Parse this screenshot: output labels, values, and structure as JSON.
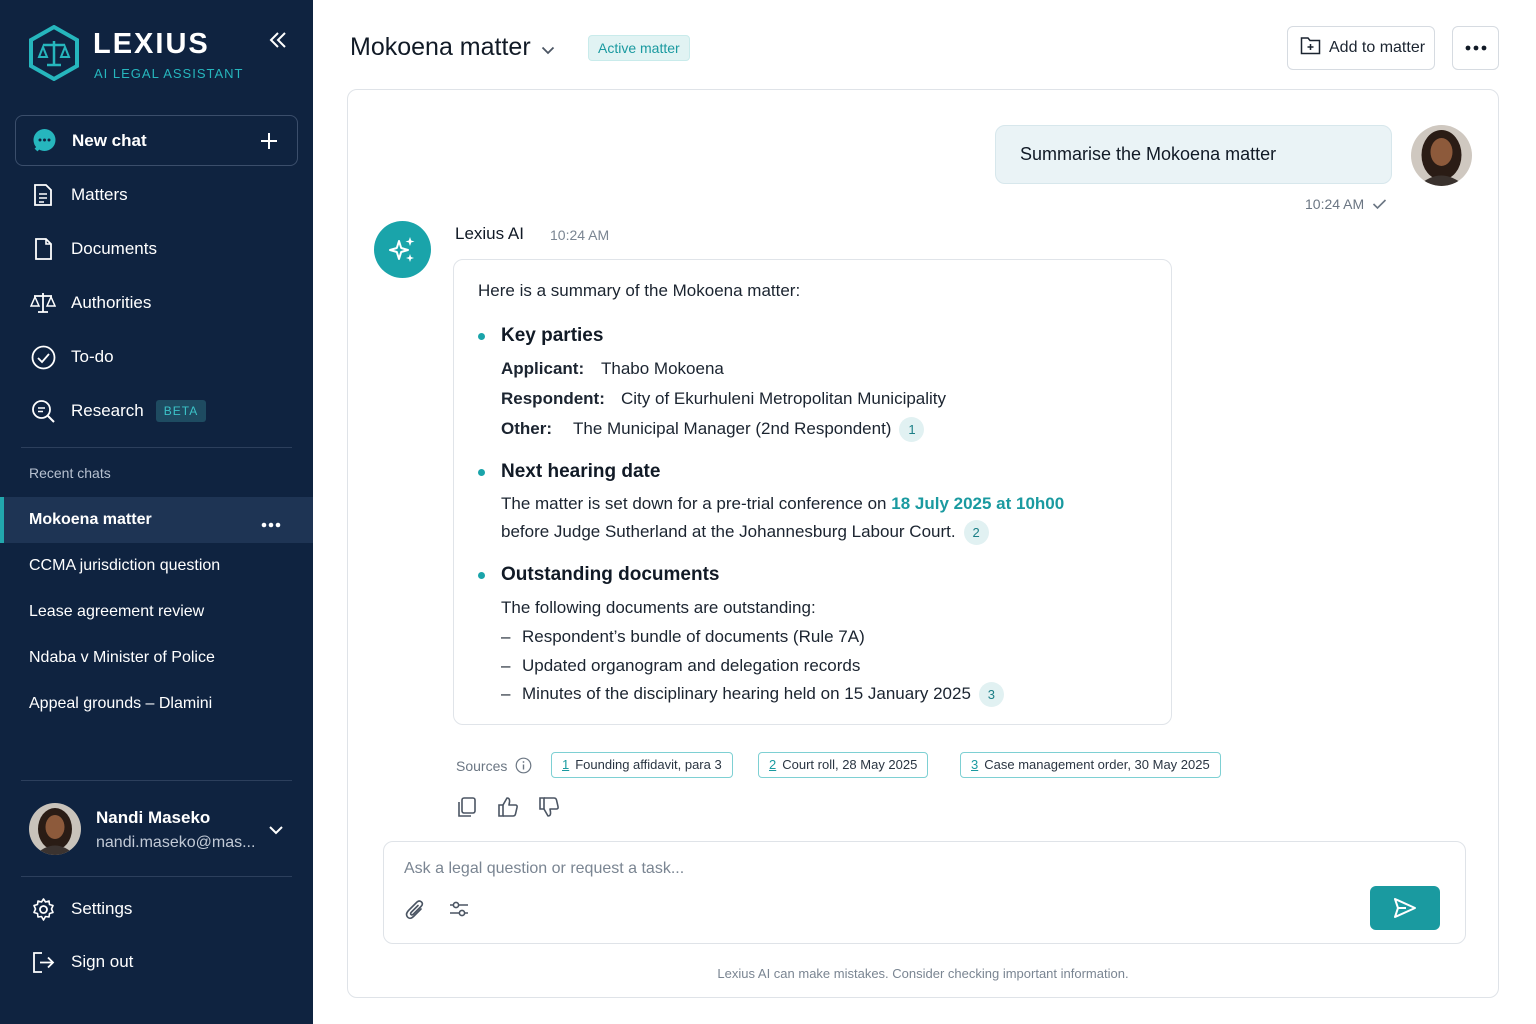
{
  "brand": {
    "name": "LEXIUS",
    "tagline": "AI LEGAL ASSISTANT"
  },
  "sidebar": {
    "new_chat": "New chat",
    "nav": [
      {
        "label": "Matters",
        "icon": "file-lines-icon"
      },
      {
        "label": "Documents",
        "icon": "document-icon"
      },
      {
        "label": "Authorities",
        "icon": "scales-icon"
      },
      {
        "label": "To-do",
        "icon": "check-circle-icon"
      },
      {
        "label": "Research",
        "icon": "search-doc-icon",
        "badge": "BETA"
      }
    ],
    "recent_title": "Recent chats",
    "recent": [
      {
        "label": "Mokoena matter",
        "active": true
      },
      {
        "label": "CCMA jurisdiction question"
      },
      {
        "label": "Lease agreement review"
      },
      {
        "label": "Ndaba v Minister of Police"
      },
      {
        "label": "Appeal grounds – Dlamini"
      }
    ],
    "user": {
      "name": "Nandi Maseko",
      "email": "nandi.maseko@mas..."
    },
    "footer": [
      {
        "label": "Settings",
        "icon": "gear-icon"
      },
      {
        "label": "Sign out",
        "icon": "sign-out-icon"
      }
    ]
  },
  "header": {
    "title": "Mokoena matter",
    "status": "Active matter",
    "add_button": "Add to matter"
  },
  "chat": {
    "user_message": "Summarise the Mokoena matter",
    "user_time": "10:24 AM",
    "ai_name": "Lexius AI",
    "ai_time": "10:24 AM",
    "intro": "Here is a summary of the Mokoena matter:",
    "sections": {
      "parties": {
        "heading": "Key parties",
        "applicant_label": "Applicant:",
        "applicant": "Thabo Mokoena",
        "respondent_label": "Respondent:",
        "respondent": "City of Ekurhuleni Metropolitan Municipality",
        "other_label": "Other:",
        "other": "The Municipal Manager (2nd Respondent)",
        "cite": "1"
      },
      "hearing": {
        "heading": "Next hearing date",
        "line1_pre": "The matter is set down for a pre-trial conference on ",
        "line1_highlight": "18 July 2025 at 10h00",
        "line2": "before Judge Sutherland at the Johannesburg Labour Court.",
        "cite": "2"
      },
      "documents": {
        "heading": "Outstanding documents",
        "intro": "The following documents are outstanding:",
        "dash": "–",
        "items": [
          "Respondent’s bundle of documents (Rule 7A)",
          "Updated organogram and delegation records",
          "Minutes of the disciplinary hearing held on 15 January 2025"
        ],
        "cite": "3"
      }
    },
    "sources_label": "Sources",
    "sources": [
      {
        "num": "1",
        "label": "Founding affidavit, para 3"
      },
      {
        "num": "2",
        "label": "Court roll, 28 May 2025"
      },
      {
        "num": "3",
        "label": "Case management order, 30 May 2025"
      }
    ]
  },
  "composer": {
    "placeholder": "Ask a legal question or request a task...",
    "disclaimer": "Lexius AI can make mistakes. Consider checking important information."
  },
  "colors": {
    "sidebar": "#0f2340",
    "accent": "#1aa4aa",
    "active_item": "#1e3454"
  }
}
